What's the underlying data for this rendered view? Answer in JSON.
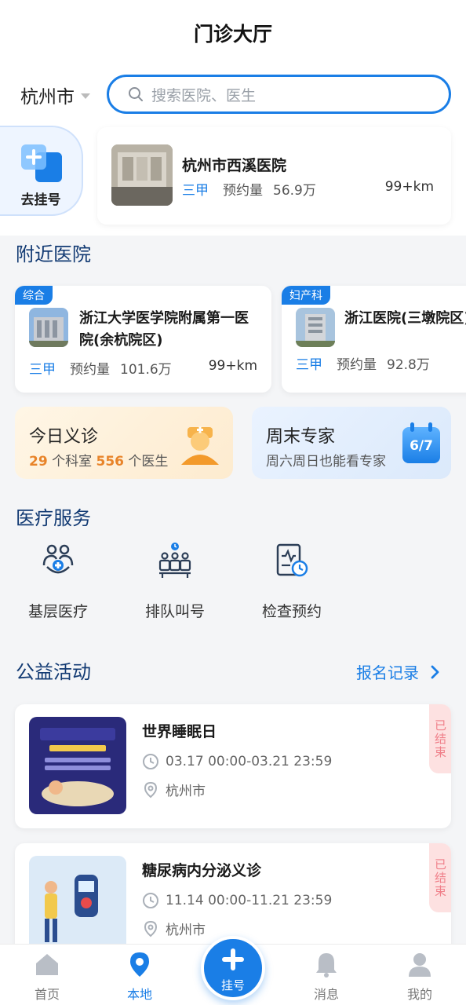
{
  "header": {
    "title": "门诊大厅"
  },
  "location": {
    "city": "杭州市"
  },
  "search": {
    "placeholder": "搜索医院、医生"
  },
  "register": {
    "label": "去挂号"
  },
  "featured_hospital": {
    "name": "杭州市西溪医院",
    "level": "三甲",
    "appt_label": "预约量",
    "appt_value": "56.9万",
    "distance": "99+km"
  },
  "nearby": {
    "title": "附近医院",
    "hospitals": [
      {
        "badge": "综合",
        "name": "浙江大学医学院附属第一医院(余杭院区)",
        "level": "三甲",
        "appt_label": "预约量",
        "appt_value": "101.6万",
        "distance": "99+km"
      },
      {
        "badge": "妇产科",
        "name": "浙江医院(三墩院区)",
        "level": "三甲",
        "appt_label": "预约量",
        "appt_value": "92.8万"
      }
    ]
  },
  "promo": {
    "free_clinic": {
      "title": "今日义诊",
      "dept_count": "29",
      "dept_label": "个科室",
      "doctor_count": "556",
      "doctor_label": "个医生"
    },
    "weekend": {
      "title": "周末专家",
      "subtitle": "周六周日也能看专家",
      "badge_text": "6/7"
    }
  },
  "services": {
    "title": "医疗服务",
    "items": [
      {
        "label": "基层医疗",
        "icon": "community-care-icon"
      },
      {
        "label": "排队叫号",
        "icon": "queue-call-icon"
      },
      {
        "label": "检查预约",
        "icon": "exam-appointment-icon"
      }
    ]
  },
  "activities": {
    "title": "公益活动",
    "records_label": "报名记录",
    "items": [
      {
        "name": "世界睡眠日",
        "time": "03.17 00:00-03.21 23:59",
        "place": "杭州市",
        "status": "已结束"
      },
      {
        "name": "糖尿病内分泌义诊",
        "time": "11.14 00:00-11.21 23:59",
        "place": "杭州市",
        "status": "已结束"
      }
    ]
  },
  "tabbar": {
    "items": [
      {
        "label": "首页"
      },
      {
        "label": "本地"
      },
      {
        "label": "挂号"
      },
      {
        "label": "消息"
      },
      {
        "label": "我的"
      }
    ],
    "active": "本地"
  },
  "colors": {
    "accent": "#1a7ee6",
    "orange": "#e8842a",
    "ended": "#f0808a"
  }
}
